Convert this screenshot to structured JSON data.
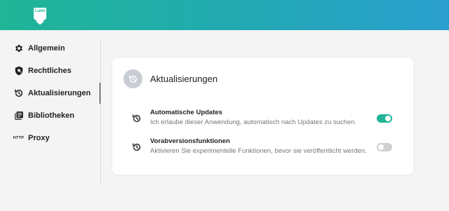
{
  "app": {
    "logo_text": "Lumi"
  },
  "sidebar": {
    "items": [
      {
        "label": "Allgemein",
        "icon": "gear-icon"
      },
      {
        "label": "Rechtliches",
        "icon": "shield-icon"
      },
      {
        "label": "Aktualisierungen",
        "icon": "history-icon",
        "active": true
      },
      {
        "label": "Bibliotheken",
        "icon": "library-icon"
      },
      {
        "label": "Proxy",
        "icon": "http-icon",
        "icon_text": "HTTP"
      }
    ]
  },
  "main": {
    "card": {
      "title": "Aktualisierungen",
      "settings": [
        {
          "title": "Automatische Updates",
          "description": "Ich erlaube dieser Anwendung, automatisch nach Updates zu suchen.",
          "enabled": true
        },
        {
          "title": "Vorabversionsfunktionen",
          "description": "Aktivieren Sie experimentelle Funktionen, bevor sie veröffentlicht werden.",
          "enabled": false
        }
      ]
    }
  },
  "colors": {
    "accent": "#1fb596",
    "header_gradient_end": "#2a9fcf",
    "toggle_off": "#cfcfcf"
  }
}
